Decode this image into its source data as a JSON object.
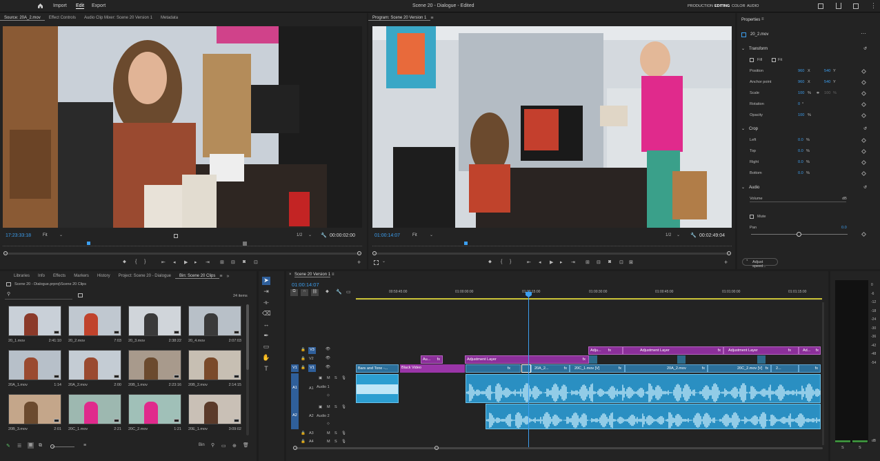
{
  "app": {
    "nav": [
      "Import",
      "Edit",
      "Export"
    ],
    "title": "Scene 20 - Dialogue - Edited",
    "workspaces": [
      "PRODUCTION",
      "EDITING",
      "COLOR",
      "AUDIO"
    ]
  },
  "source": {
    "tabs": [
      "Source: 20A_2.mov",
      "Effect Controls",
      "Audio Clip Mixer: Scene 20 Version 1",
      "Metadata"
    ],
    "timecode": "17:23:33:18",
    "fit": "Fit",
    "resolution": "1/2",
    "duration": "00:00:02:00"
  },
  "program": {
    "tab": "Program: Scene 20 Version 1",
    "timecode": "01:00:14:07",
    "fit": "Fit",
    "resolution": "1/2",
    "duration": "00:02:49:04"
  },
  "properties": {
    "title": "Properties",
    "clip": "20_2.mov",
    "transform": "Transform",
    "fill": "Fill",
    "fit": "Fit",
    "position_label": "Position",
    "position_x": "960",
    "position_y": "540",
    "anchor_label": "Anchor point",
    "anchor_x": "960",
    "anchor_y": "540",
    "scale_label": "Scale",
    "scale": "100",
    "scale2": "100",
    "rotation_label": "Rotation",
    "rotation": "0",
    "opacity_label": "Opacity",
    "opacity": "100",
    "crop": "Crop",
    "left_label": "Left",
    "left": "0.0",
    "top_label": "Top",
    "top": "0.0",
    "right_label": "Right",
    "right": "0.0",
    "bottom_label": "Bottom",
    "bottom": "0.0",
    "audio": "Audio",
    "volume_label": "Volume",
    "volume_unit": "dB",
    "mute": "Mute",
    "pan_label": "Pan",
    "pan": "0.0",
    "adjust_speed": "Adjust speed..."
  },
  "project": {
    "tabs": [
      "Libraries",
      "Info",
      "Effects",
      "Markers",
      "History",
      "Project: Scene 20 - Dialogue",
      "Bin: Scene 20 Clips"
    ],
    "path": "Scene 20 - Dialogue.prproj\\Scene 20 Clips",
    "items_count": "24 items",
    "clips": [
      {
        "name": "20_1.mov",
        "dur": "2:41:10"
      },
      {
        "name": "20_2.mov",
        "dur": "7:03"
      },
      {
        "name": "20_3.mov",
        "dur": "2:38:22"
      },
      {
        "name": "20_4.mov",
        "dur": "2:07:03"
      },
      {
        "name": "20A_1.mov",
        "dur": "1:14"
      },
      {
        "name": "20A_2.mov",
        "dur": "2:00"
      },
      {
        "name": "20B_1.mov",
        "dur": "2:23:16"
      },
      {
        "name": "20B_2.mov",
        "dur": "2:14:15"
      },
      {
        "name": "20B_3.mov",
        "dur": "2:01"
      },
      {
        "name": "20C_1.mov",
        "dur": "2:21"
      },
      {
        "name": "20C_2.mov",
        "dur": "1:21"
      },
      {
        "name": "20E_1.mov",
        "dur": "3:09:02"
      }
    ]
  },
  "timeline": {
    "tab": "Scene 20 Version 1",
    "timecode": "01:00:14:07",
    "ruler": [
      "00:59:45:00",
      "01:00:00:00",
      "01:00:15:00",
      "01:00:30:00",
      "01:00:45:00",
      "01:01:00:00",
      "01:01:15:00"
    ],
    "tracks": {
      "v3": "V3",
      "v2": "V2",
      "v1": "V1",
      "a1": "A1",
      "a1_name": "Audio 1",
      "a2": "A2",
      "a2_name": "Audio 2",
      "a3": "A3",
      "a4": "A4"
    },
    "clips": {
      "bars": "Bars and Tone -...",
      "black": "Black Video",
      "adj": "Adjustment Layer",
      "adj_short": "Adju...",
      "au": "Au...",
      "ad": "Ad...",
      "c20a2": "20A_2...",
      "c20c1": "20C_1.mov [V]",
      "c20a2b": "20A_2.mov",
      "c20c2": "20C_2.mov [V]",
      "c2": "2...",
      "fx": "fx"
    }
  },
  "meter": {
    "labels": [
      "0",
      "-6",
      "-12",
      "-18",
      "-24",
      "-30",
      "-36",
      "-42",
      "-48",
      "-54"
    ],
    "db": "dB",
    "s1": "S",
    "s2": "S"
  }
}
